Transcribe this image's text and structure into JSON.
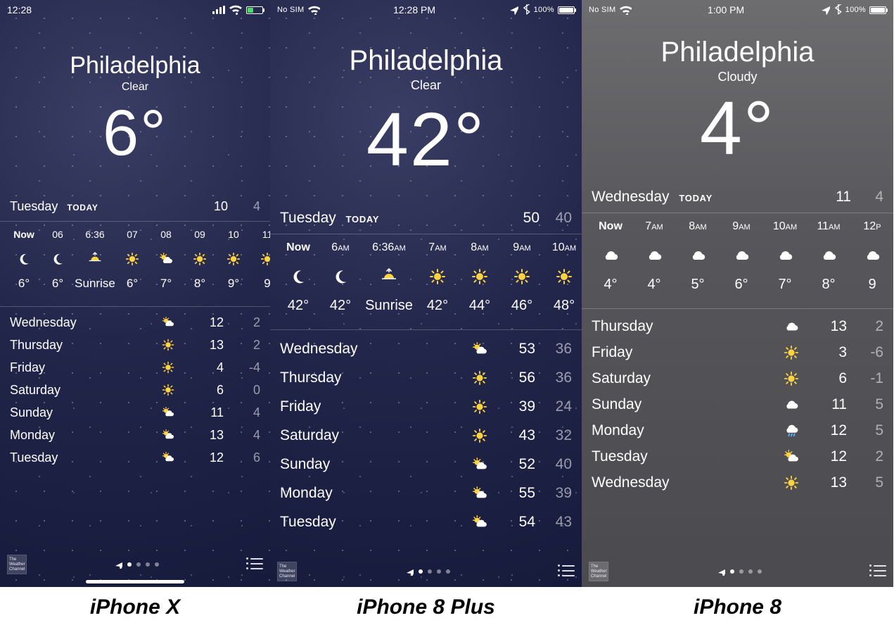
{
  "captions": [
    "iPhone X",
    "iPhone 8 Plus",
    "iPhone 8"
  ],
  "phones": [
    {
      "status": {
        "time": "12:28",
        "carrier": "",
        "battery_pct": "",
        "battery_fill": 40,
        "battery_green": true,
        "show_center_time": false,
        "show_bt": false,
        "show_loc": false
      },
      "city": "Philadelphia",
      "condition": "Clear",
      "temp": "6°",
      "today": {
        "day": "Tuesday",
        "tag": "TODAY",
        "hi": "10",
        "lo": "4"
      },
      "hourly": [
        {
          "time": "Now",
          "ampm": "",
          "icon": "moon",
          "temp": "6°",
          "now": true
        },
        {
          "time": "06",
          "ampm": "",
          "icon": "moon",
          "temp": "6°"
        },
        {
          "time": "6:36",
          "ampm": "",
          "icon": "sunrise",
          "temp": "Sunrise",
          "wide": true
        },
        {
          "time": "07",
          "ampm": "",
          "icon": "sun",
          "temp": "6°"
        },
        {
          "time": "08",
          "ampm": "",
          "icon": "partly",
          "temp": "7°"
        },
        {
          "time": "09",
          "ampm": "",
          "icon": "sun",
          "temp": "8°"
        },
        {
          "time": "10",
          "ampm": "",
          "icon": "sun",
          "temp": "9°"
        },
        {
          "time": "11",
          "ampm": "",
          "icon": "sun",
          "temp": "9"
        }
      ],
      "daily": [
        {
          "day": "Wednesday",
          "icon": "partly",
          "hi": "12",
          "lo": "2"
        },
        {
          "day": "Thursday",
          "icon": "sun",
          "hi": "13",
          "lo": "2"
        },
        {
          "day": "Friday",
          "icon": "sun",
          "hi": "4",
          "lo": "-4"
        },
        {
          "day": "Saturday",
          "icon": "sun",
          "hi": "6",
          "lo": "0"
        },
        {
          "day": "Sunday",
          "icon": "partly",
          "hi": "11",
          "lo": "4"
        },
        {
          "day": "Monday",
          "icon": "partly",
          "hi": "13",
          "lo": "4"
        },
        {
          "day": "Tuesday",
          "icon": "partly",
          "hi": "12",
          "lo": "6"
        }
      ],
      "dots": 4,
      "homebar": true,
      "twc": "The Weather Channel"
    },
    {
      "status": {
        "time": "12:28 PM",
        "carrier": "No SIM",
        "battery_pct": "100%",
        "battery_fill": 100,
        "battery_green": false,
        "show_center_time": true,
        "show_bt": true,
        "show_loc": true
      },
      "city": "Philadelphia",
      "condition": "Clear",
      "temp": "42°",
      "today": {
        "day": "Tuesday",
        "tag": "TODAY",
        "hi": "50",
        "lo": "40"
      },
      "hourly": [
        {
          "time": "Now",
          "ampm": "",
          "icon": "moon",
          "temp": "42°",
          "now": true
        },
        {
          "time": "6",
          "ampm": "AM",
          "icon": "moon",
          "temp": "42°"
        },
        {
          "time": "6:36",
          "ampm": "AM",
          "icon": "sunrise",
          "temp": "Sunrise",
          "wide": true
        },
        {
          "time": "7",
          "ampm": "AM",
          "icon": "sun",
          "temp": "42°"
        },
        {
          "time": "8",
          "ampm": "AM",
          "icon": "sun",
          "temp": "44°"
        },
        {
          "time": "9",
          "ampm": "AM",
          "icon": "sun",
          "temp": "46°"
        },
        {
          "time": "10",
          "ampm": "AM",
          "icon": "sun",
          "temp": "48°"
        }
      ],
      "daily": [
        {
          "day": "Wednesday",
          "icon": "partly",
          "hi": "53",
          "lo": "36"
        },
        {
          "day": "Thursday",
          "icon": "sun",
          "hi": "56",
          "lo": "36"
        },
        {
          "day": "Friday",
          "icon": "sun",
          "hi": "39",
          "lo": "24"
        },
        {
          "day": "Saturday",
          "icon": "sun",
          "hi": "43",
          "lo": "32"
        },
        {
          "day": "Sunday",
          "icon": "partly",
          "hi": "52",
          "lo": "40"
        },
        {
          "day": "Monday",
          "icon": "partly",
          "hi": "55",
          "lo": "39"
        },
        {
          "day": "Tuesday",
          "icon": "partly",
          "hi": "54",
          "lo": "43"
        }
      ],
      "dots": 4,
      "homebar": false,
      "twc": "The Weather Channel"
    },
    {
      "status": {
        "time": "1:00 PM",
        "carrier": "No SIM",
        "battery_pct": "100%",
        "battery_fill": 100,
        "battery_green": false,
        "show_center_time": true,
        "show_bt": true,
        "show_loc": true
      },
      "city": "Philadelphia",
      "condition": "Cloudy",
      "temp": "4°",
      "today": {
        "day": "Wednesday",
        "tag": "TODAY",
        "hi": "11",
        "lo": "4"
      },
      "hourly": [
        {
          "time": "Now",
          "ampm": "",
          "icon": "cloud",
          "temp": "4°",
          "now": true
        },
        {
          "time": "7",
          "ampm": "AM",
          "icon": "cloud",
          "temp": "4°"
        },
        {
          "time": "8",
          "ampm": "AM",
          "icon": "cloud",
          "temp": "5°"
        },
        {
          "time": "9",
          "ampm": "AM",
          "icon": "cloud",
          "temp": "6°"
        },
        {
          "time": "10",
          "ampm": "AM",
          "icon": "cloud",
          "temp": "7°"
        },
        {
          "time": "11",
          "ampm": "AM",
          "icon": "cloud",
          "temp": "8°"
        },
        {
          "time": "12",
          "ampm": "P",
          "icon": "cloud",
          "temp": "9"
        }
      ],
      "daily": [
        {
          "day": "Thursday",
          "icon": "cloud",
          "hi": "13",
          "lo": "2"
        },
        {
          "day": "Friday",
          "icon": "sun",
          "hi": "3",
          "lo": "-6"
        },
        {
          "day": "Saturday",
          "icon": "sun",
          "hi": "6",
          "lo": "-1"
        },
        {
          "day": "Sunday",
          "icon": "cloud",
          "hi": "11",
          "lo": "5"
        },
        {
          "day": "Monday",
          "icon": "rain",
          "hi": "12",
          "lo": "5"
        },
        {
          "day": "Tuesday",
          "icon": "partly",
          "hi": "12",
          "lo": "2"
        },
        {
          "day": "Wednesday",
          "icon": "sun",
          "hi": "13",
          "lo": "5"
        }
      ],
      "dots": 4,
      "homebar": false,
      "twc": "The Weather Channel"
    }
  ]
}
